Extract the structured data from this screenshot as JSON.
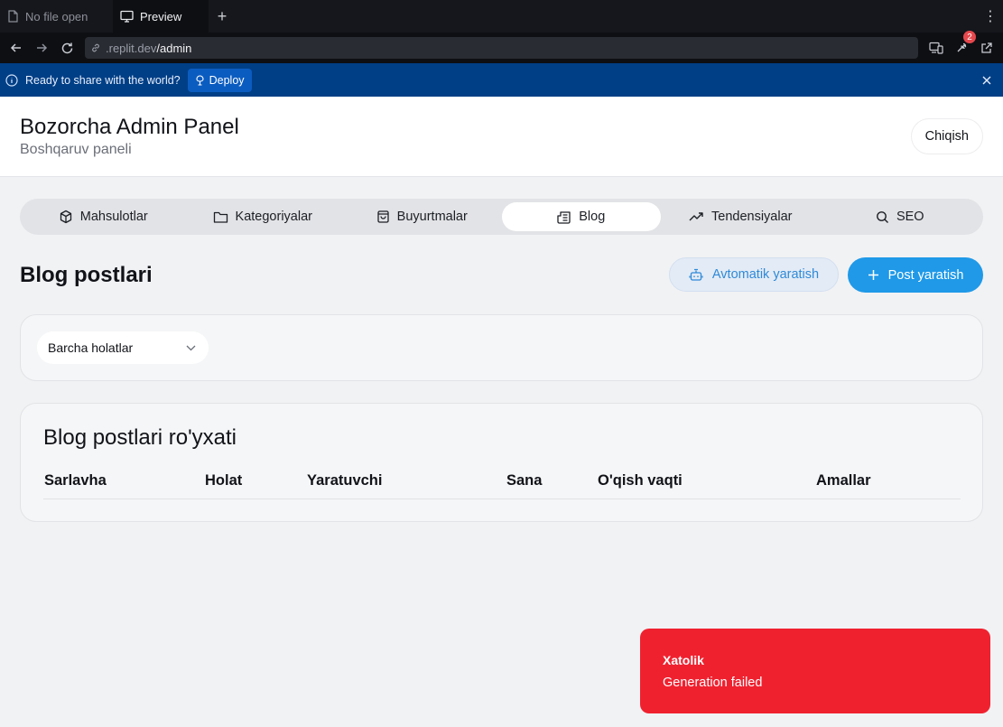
{
  "browser": {
    "tabs": [
      {
        "label": "No file open",
        "icon": "file-icon"
      },
      {
        "label": "Preview",
        "icon": "monitor-icon"
      }
    ],
    "url_prefix": ".replit.dev",
    "url_path": "/admin",
    "notification_count": "2"
  },
  "deploy_banner": {
    "message": "Ready to share with the world?",
    "button_label": "Deploy"
  },
  "header": {
    "title": "Bozorcha Admin Panel",
    "subtitle": "Boshqaruv paneli",
    "logout_label": "Chiqish"
  },
  "nav": {
    "tabs": [
      {
        "label": "Mahsulotlar",
        "icon": "box-icon"
      },
      {
        "label": "Kategoriyalar",
        "icon": "folder-icon"
      },
      {
        "label": "Buyurtmalar",
        "icon": "shopping-bag-icon"
      },
      {
        "label": "Blog",
        "icon": "newspaper-icon",
        "active": true
      },
      {
        "label": "Tendensiyalar",
        "icon": "trending-up-icon"
      },
      {
        "label": "SEO",
        "icon": "search-icon"
      }
    ]
  },
  "page": {
    "title": "Blog postlari",
    "auto_generate_label": "Avtomatik yaratish",
    "create_post_label": "Post yaratish"
  },
  "filter": {
    "status_selected": "Barcha holatlar"
  },
  "list": {
    "title": "Blog postlari ro'yxati",
    "columns": [
      "Sarlavha",
      "Holat",
      "Yaratuvchi",
      "Sana",
      "O'qish vaqti",
      "Amallar"
    ]
  },
  "toast": {
    "title": "Xatolik",
    "description": "Generation failed"
  },
  "colors": {
    "accent": "#1f99e8",
    "error": "#f0212f",
    "deploy_banner": "#003f86"
  }
}
